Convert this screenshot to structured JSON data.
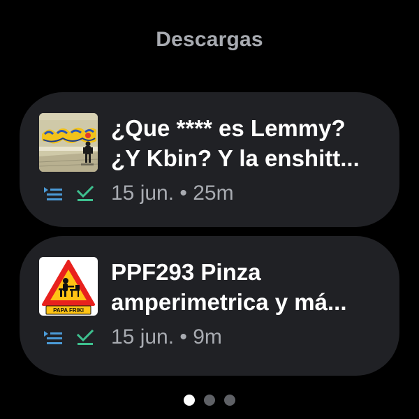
{
  "header": {
    "title": "Descargas"
  },
  "episodes": [
    {
      "title_line1": "¿Que **** es Lemmy?",
      "title_line2": "¿Y Kbin? Y la enshitt...",
      "date": "15 jun.",
      "separator": "•",
      "duration": "25m",
      "meta": "15 jun. • 25m",
      "thumbnail": "podcast-artwork-graffiti",
      "status_icons": [
        "queue-icon",
        "downloaded-check-icon"
      ]
    },
    {
      "title_line1": "PPF293 Pinza",
      "title_line2": "amperimetrica y má...",
      "date": "15 jun.",
      "separator": "•",
      "duration": "9m",
      "meta": "15 jun. • 9m",
      "thumbnail": "papa-friki-logo",
      "thumbnail_text": "PAPA FRIKI",
      "status_icons": [
        "queue-icon",
        "downloaded-check-icon"
      ]
    }
  ],
  "pager": {
    "count": 3,
    "active_index": 0
  },
  "colors": {
    "background": "#000000",
    "card": "#202125",
    "header_text": "#a8abb1",
    "meta_text": "#a8abb1",
    "queue_icon": "#4b9bd8",
    "check_icon": "#3ec08f",
    "dot_active": "#ffffff",
    "dot_inactive": "#5f6166"
  }
}
